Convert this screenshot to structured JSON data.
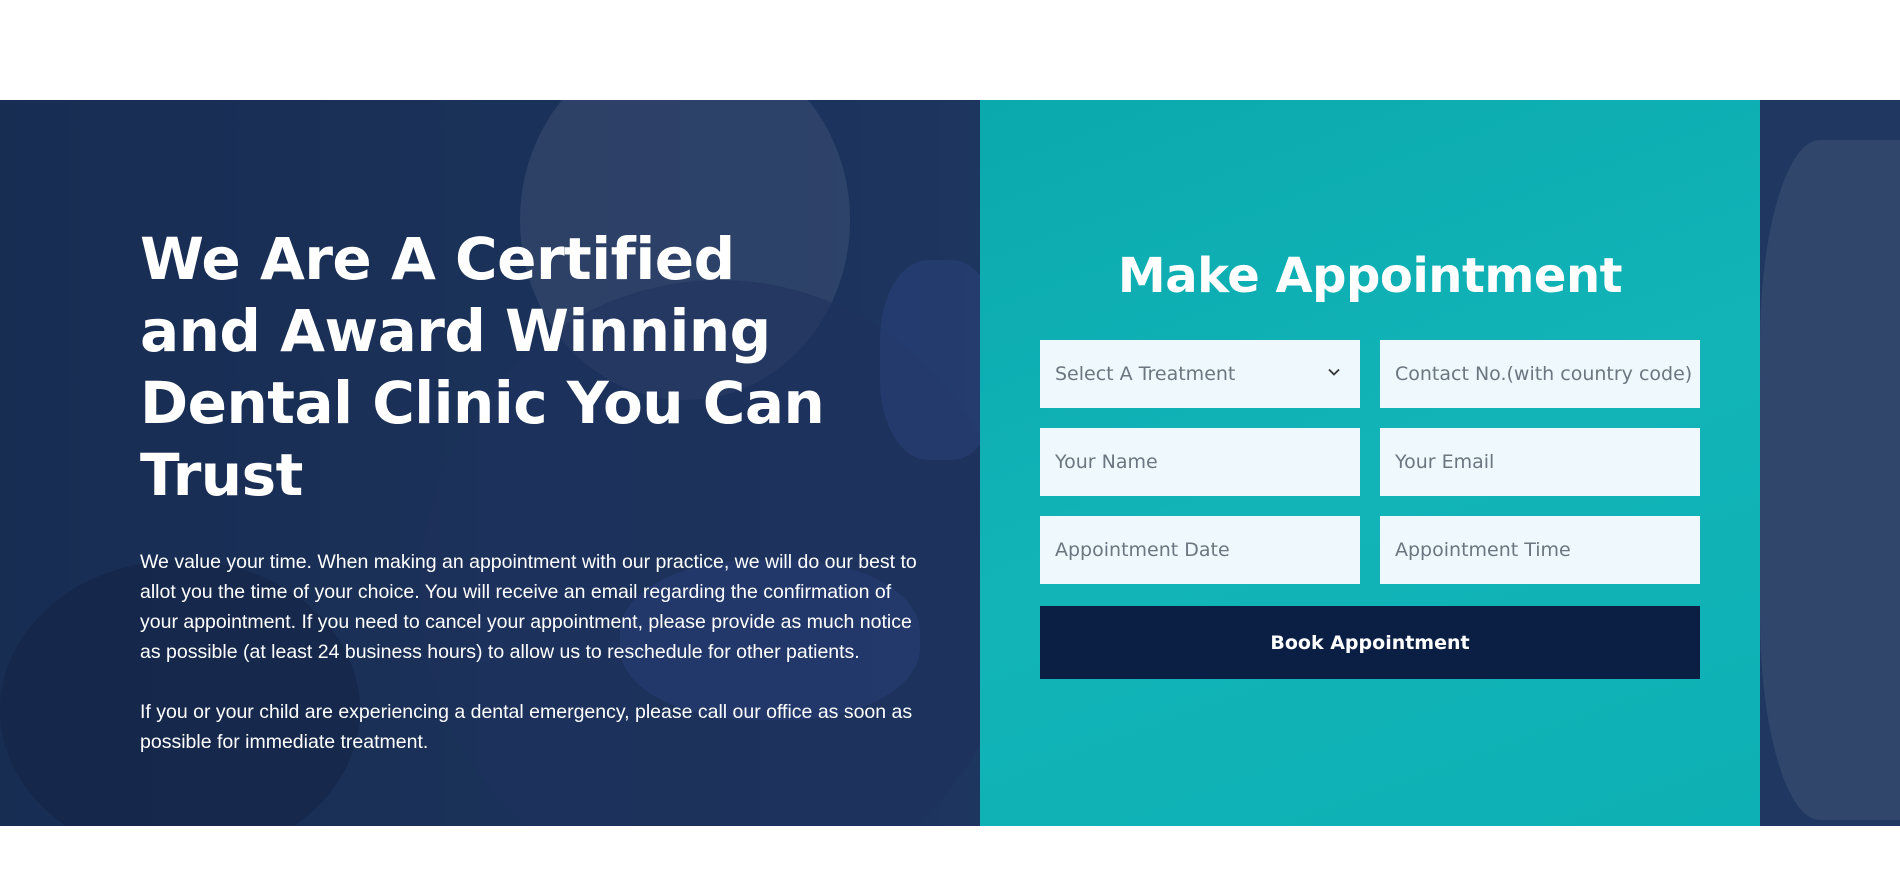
{
  "hero": {
    "title": "We Are A Certified and Award Winning Dental Clinic You Can Trust",
    "paragraph_1": "We value your time. When making an appointment with our practice, we will do our best to allot you the time of your choice. You will receive an email regarding the confirmation of your appointment. If you need to cancel your appointment, please provide as much notice as possible (at least 24 business hours) to allow us to reschedule for other patients.",
    "paragraph_2": "If you or your child are experiencing a dental emergency, please call our office as soon as possible for immediate treatment."
  },
  "form": {
    "title": "Make Appointment",
    "treatment_select": "Select A Treatment",
    "contact_placeholder": "Contact No.(with country code)",
    "name_placeholder": "Your Name",
    "email_placeholder": "Your Email",
    "date_placeholder": "Appointment Date",
    "time_placeholder": "Appointment Time",
    "submit_label": "Book Appointment"
  },
  "colors": {
    "hero_bg": "#1c3358",
    "form_bg": "#0aa9ae",
    "field_bg": "#eef8fd",
    "button_bg": "#0b1f45"
  }
}
